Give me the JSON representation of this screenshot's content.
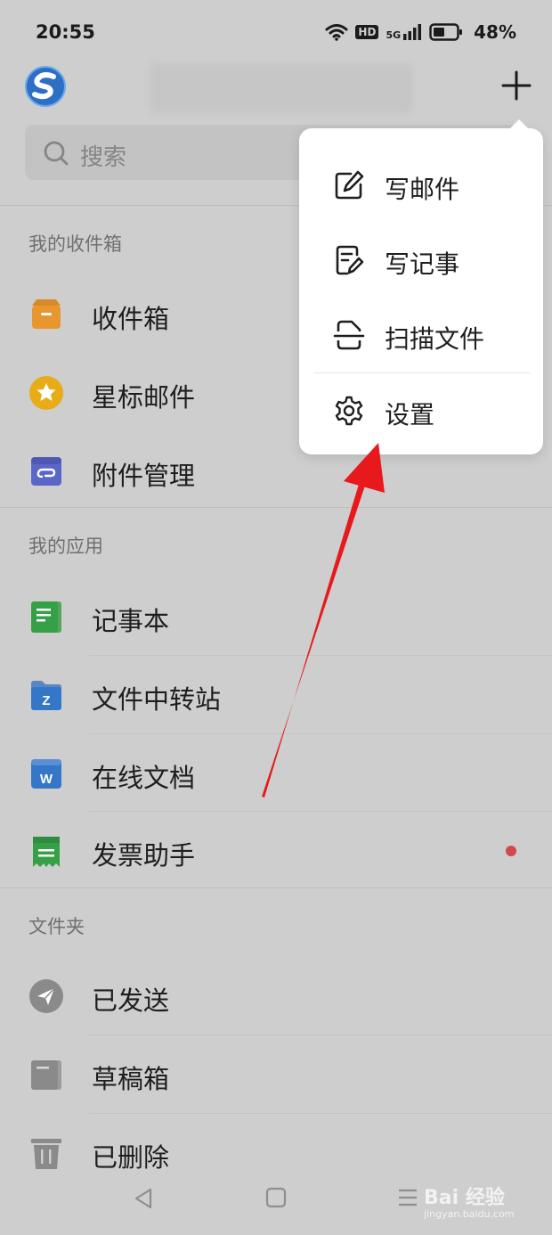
{
  "status_bar": {
    "time": "20:55",
    "network": "5G",
    "hd": "HD",
    "battery": "48%"
  },
  "search": {
    "placeholder": "搜索"
  },
  "sections": [
    {
      "title": "我的收件箱",
      "items": [
        {
          "label": "收件箱",
          "icon": "inbox-icon"
        },
        {
          "label": "星标邮件",
          "icon": "star-icon"
        },
        {
          "label": "附件管理",
          "icon": "attachment-icon"
        }
      ]
    },
    {
      "title": "我的应用",
      "items": [
        {
          "label": "记事本",
          "icon": "notebook-icon"
        },
        {
          "label": "文件中转站",
          "icon": "file-transfer-icon"
        },
        {
          "label": "在线文档",
          "icon": "online-doc-icon"
        },
        {
          "label": "发票助手",
          "icon": "invoice-icon",
          "badge": true
        }
      ]
    },
    {
      "title": "文件夹",
      "items": [
        {
          "label": "已发送",
          "icon": "sent-icon"
        },
        {
          "label": "草稿箱",
          "icon": "drafts-icon"
        },
        {
          "label": "已删除",
          "icon": "trash-icon"
        }
      ]
    }
  ],
  "menu": {
    "items": [
      {
        "label": "写邮件",
        "icon": "compose-icon"
      },
      {
        "label": "写记事",
        "icon": "note-icon"
      },
      {
        "label": "扫描文件",
        "icon": "scan-icon"
      },
      {
        "label": "设置",
        "icon": "gear-icon"
      }
    ]
  },
  "watermark": {
    "main": "Bai 经验",
    "sub": "jingyan.baidu.com"
  },
  "colors": {
    "annotation_arrow": "#e8191c",
    "background": "#cecece",
    "badge": "#cf4b4b"
  }
}
